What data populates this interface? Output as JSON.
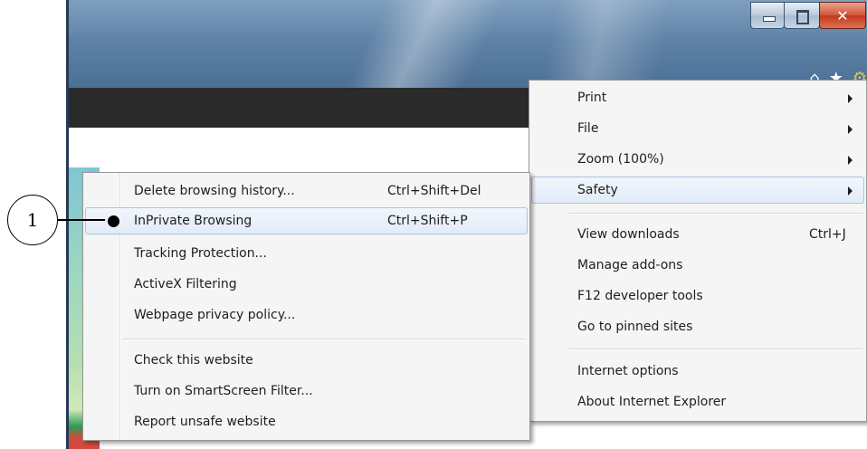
{
  "window": {
    "caption_buttons": {
      "minimize": "minimize-icon",
      "restore": "restore-icon",
      "close": "✕"
    },
    "toolbar_icons": [
      "home-icon",
      "favorites-star-icon",
      "tools-gear-icon"
    ]
  },
  "main_menu": {
    "items": [
      {
        "label": "Print",
        "shortcut": "",
        "submenu": true
      },
      {
        "label": "File",
        "shortcut": "",
        "submenu": true
      },
      {
        "label": "Zoom (100%)",
        "shortcut": "",
        "submenu": true
      },
      {
        "label": "Safety",
        "shortcut": "",
        "submenu": true,
        "highlighted": true
      },
      {
        "label": "View downloads",
        "shortcut": "Ctrl+J",
        "submenu": false
      },
      {
        "label": "Manage add-ons",
        "shortcut": "",
        "submenu": false
      },
      {
        "label": "F12 developer tools",
        "shortcut": "",
        "submenu": false
      },
      {
        "label": "Go to pinned sites",
        "shortcut": "",
        "submenu": false
      },
      {
        "label": "Internet options",
        "shortcut": "",
        "submenu": false
      },
      {
        "label": "About Internet Explorer",
        "shortcut": "",
        "submenu": false
      }
    ]
  },
  "safety_menu": {
    "items": [
      {
        "label": "Delete browsing history...",
        "shortcut": "Ctrl+Shift+Del"
      },
      {
        "label": "InPrivate Browsing",
        "shortcut": "Ctrl+Shift+P",
        "highlighted": true,
        "bullet": true
      },
      {
        "label": "Tracking Protection...",
        "shortcut": ""
      },
      {
        "label": "ActiveX Filtering",
        "shortcut": ""
      },
      {
        "label": "Webpage privacy policy...",
        "shortcut": ""
      },
      {
        "label": "Check this website",
        "shortcut": ""
      },
      {
        "label": "Turn on SmartScreen Filter...",
        "shortcut": ""
      },
      {
        "label": "Report unsafe website",
        "shortcut": ""
      }
    ]
  },
  "callout": {
    "number": "1"
  },
  "colors": {
    "highlight_border": "#a8c3e3",
    "menu_background": "#f5f5f5",
    "close_button": "#c2381b"
  }
}
